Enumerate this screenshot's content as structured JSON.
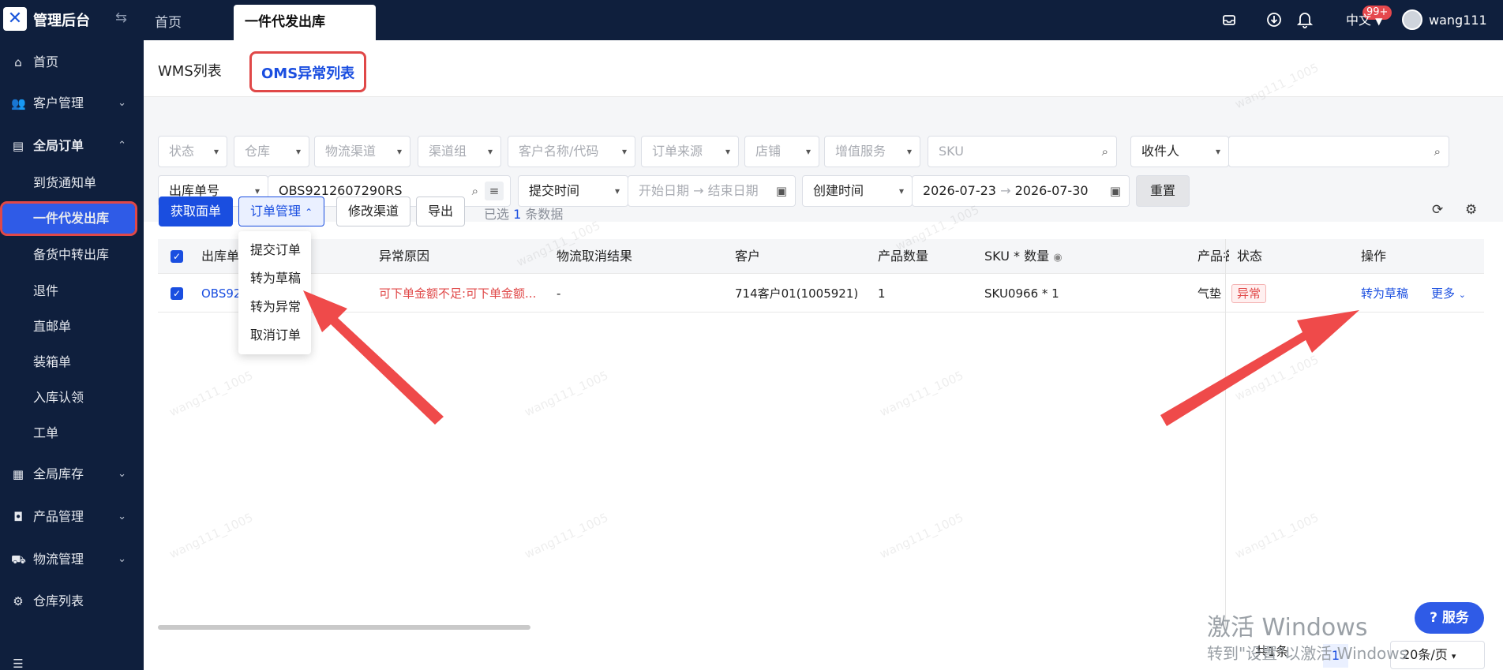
{
  "app": {
    "title": "管理后台"
  },
  "topbar": {
    "tabs": [
      {
        "label": "首页"
      },
      {
        "label": "一件代发出库"
      }
    ],
    "notification_badge": "99+",
    "language": "中文",
    "username": "wang111"
  },
  "sidebar": {
    "items": [
      {
        "label": "首页",
        "icon": "home-icon"
      },
      {
        "label": "客户管理",
        "icon": "users-icon"
      },
      {
        "label": "全局订单",
        "icon": "order-icon"
      },
      {
        "label": "全局库存",
        "icon": "warehouse-icon"
      },
      {
        "label": "产品管理",
        "icon": "product-icon"
      },
      {
        "label": "物流管理",
        "icon": "truck-icon"
      },
      {
        "label": "仓库列表",
        "icon": "gear-icon"
      }
    ],
    "sub_items": [
      "到货通知单",
      "一件代发出库",
      "备货中转出库",
      "退件",
      "直邮单",
      "装箱单",
      "入库认领",
      "工单"
    ]
  },
  "subtabs": {
    "wms": "WMS列表",
    "oms": "OMS异常列表"
  },
  "filters": {
    "status": "状态",
    "warehouse": "仓库",
    "logistics_channel": "物流渠道",
    "channel_group": "渠道组",
    "customer": "客户名称/代码",
    "order_source": "订单来源",
    "store": "店铺",
    "value_added": "增值服务",
    "sku_placeholder": "SKU",
    "receiver": "收件人",
    "order_no_type": "出库单号",
    "order_no_value": "OBS9212607290RS",
    "submit_time": "提交时间",
    "start_date": "开始日期",
    "end_date": "结束日期",
    "create_time": "创建时间",
    "create_start": "2026-07-23",
    "create_end": "2026-07-30",
    "reset": "重置"
  },
  "toolbar": {
    "get_label": "获取面单",
    "order_mgmt": "订单管理",
    "modify_channel": "修改渠道",
    "export": "导出",
    "selected_prefix": "已选",
    "selected_count": "1",
    "selected_suffix": "条数据"
  },
  "dropdown": [
    "提交订单",
    "转为草稿",
    "转为异常",
    "取消订单"
  ],
  "table": {
    "headers": [
      "出库单",
      "异常原因",
      "物流取消结果",
      "客户",
      "产品数量",
      "SKU * 数量",
      "产品名",
      "状态",
      "操作"
    ],
    "rows": [
      {
        "order_no": "OBS92",
        "reason": "可下单金额不足:可下单金额...",
        "cancel_result": "-",
        "customer": "714客户01(1005921)",
        "qty": "1",
        "sku": "SKU0966 * 1",
        "product": "气垫",
        "status": "异常",
        "action": "转为草稿",
        "more": "更多"
      }
    ]
  },
  "pagination": {
    "total": "共1条",
    "current": "1",
    "page_size": "20条/页"
  },
  "service": "服务",
  "windows_activation": {
    "title": "激活 Windows",
    "subtitle": "转到\"设置\"以激活 Windows"
  },
  "watermark": "wang111_1005"
}
